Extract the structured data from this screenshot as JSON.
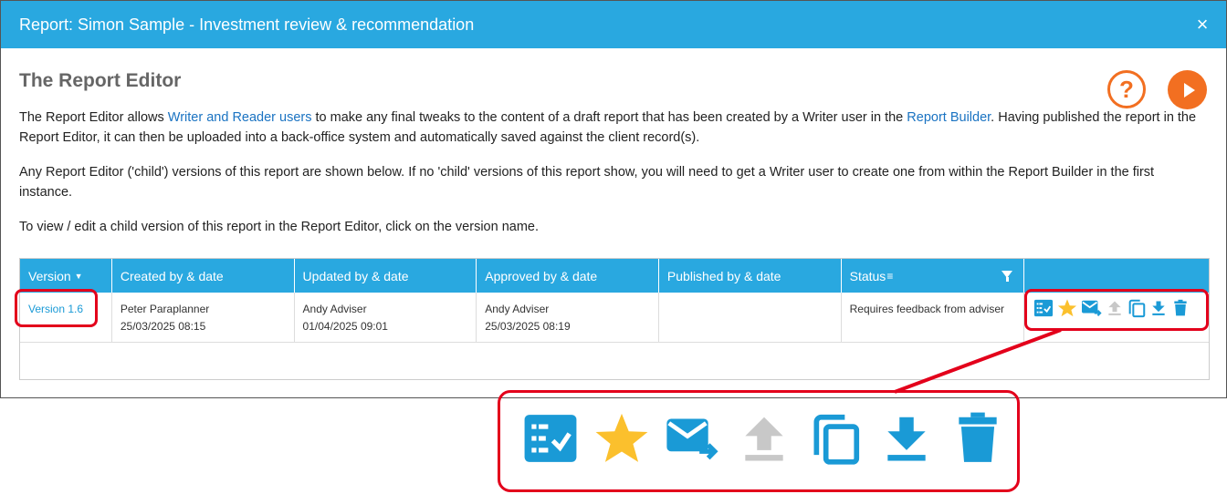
{
  "dialog": {
    "title": "Report: Simon Sample - Investment review & recommendation",
    "close_glyph": "×"
  },
  "editor": {
    "heading": "The Report Editor",
    "help_glyph": "?",
    "para1_a": "The Report Editor allows ",
    "para1_link1": "Writer and Reader users",
    "para1_b": " to make any final tweaks to the content of a draft report that has been created by a Writer user in the ",
    "para1_link2": "Report Builder",
    "para1_c": ". Having published the report in the Report Editor, it can then be uploaded into a back-office system and automatically saved against the client record(s).",
    "para2": "Any Report Editor ('child') versions of this report are shown below. If no 'child' versions of this report show, you will need to get a Writer user to create one from within the Report Builder in the first instance.",
    "para3": "To view / edit a child version of this report in the Report Editor, click on the version name."
  },
  "table": {
    "headers": [
      "Version",
      "Created by & date",
      "Updated by & date",
      "Approved by & date",
      "Published by & date",
      "Status",
      ""
    ],
    "rows": [
      {
        "version": "Version 1.6",
        "created_by": "Peter Paraplanner",
        "created_date": "25/03/2025 08:15",
        "updated_by": "Andy Adviser",
        "updated_date": "01/04/2025 09:01",
        "approved_by": "Andy Adviser",
        "approved_date": "25/03/2025 08:19",
        "published_by": "",
        "published_date": "",
        "status": "Requires feedback from adviser"
      }
    ]
  },
  "actions": [
    "checklist-icon",
    "star-icon",
    "email-forward-icon",
    "upload-icon",
    "copy-icon",
    "download-icon",
    "delete-icon"
  ],
  "colors": {
    "header_blue": "#29a8e0",
    "action_blue": "#1a9ad6",
    "star_yellow": "#fbc02d",
    "disabled_grey": "#c8c8c8",
    "orange": "#f26f21",
    "highlight_red": "#e3001b"
  }
}
